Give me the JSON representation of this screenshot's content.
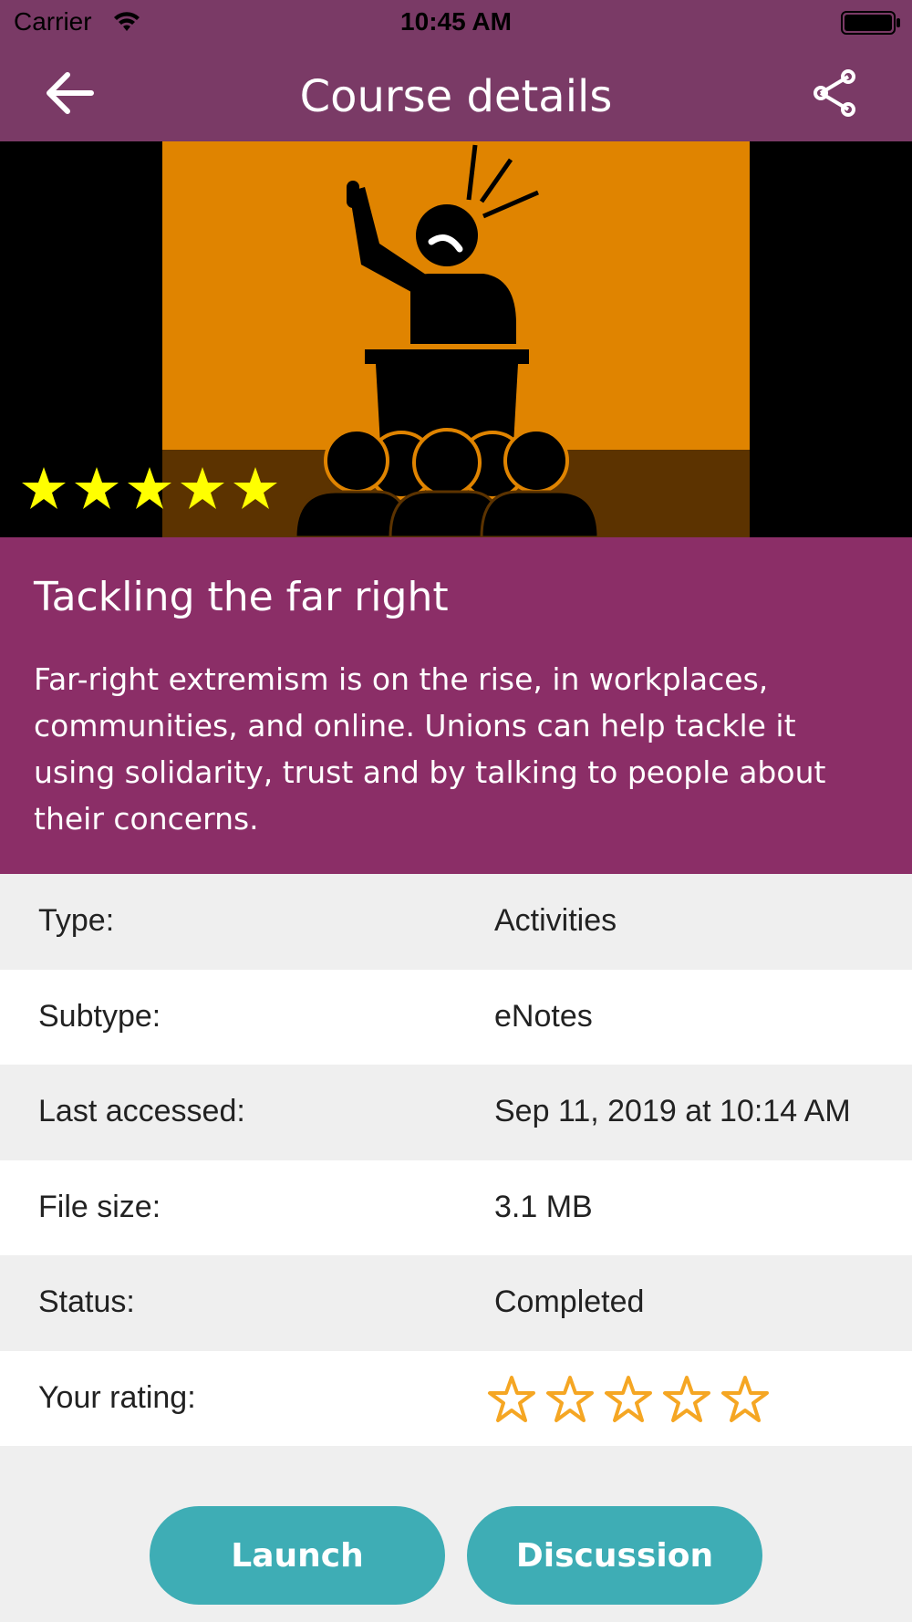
{
  "status_bar": {
    "carrier": "Carrier",
    "time": "10:45 AM"
  },
  "nav": {
    "title": "Course details",
    "back_icon": "arrow-left-icon",
    "share_icon": "share-icon"
  },
  "hero": {
    "image": "speaker-at-podium-with-audience",
    "rating": 5,
    "max_rating": 5
  },
  "course": {
    "title": "Tackling the far right",
    "description": "Far-right extremism is on the rise, in workplaces, communities, and online. Unions can help tackle it using solidarity, trust and by talking to people about their concerns."
  },
  "details": [
    {
      "label": "Type:",
      "value": "Activities"
    },
    {
      "label": "Subtype:",
      "value": "eNotes"
    },
    {
      "label": "Last accessed:",
      "value": "Sep 11, 2019 at 10:14 AM"
    },
    {
      "label": "File size:",
      "value": "3.1 MB"
    },
    {
      "label": "Status:",
      "value": "Completed"
    },
    {
      "label": "Your rating:",
      "value": ""
    }
  ],
  "your_rating": {
    "value": 0,
    "max": 5
  },
  "actions": {
    "launch_label": "Launch",
    "discussion_label": "Discussion"
  },
  "colors": {
    "header": "#7a3a66",
    "info_panel": "#8b2e67",
    "button": "#3eadb5",
    "hero_stars": "#ffff00",
    "rating_star_outline": "#f5a623",
    "hero_orange": "#e08400"
  }
}
